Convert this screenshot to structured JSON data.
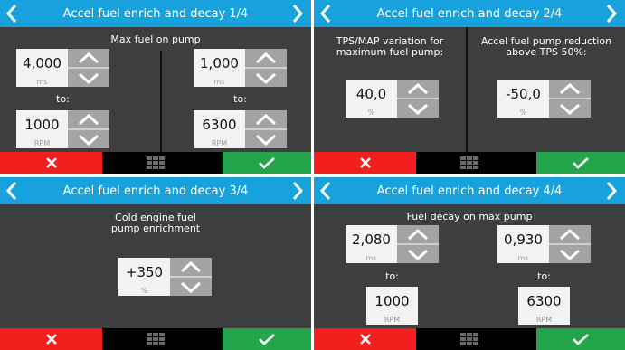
{
  "screens": [
    {
      "title": "Accel fuel enrich and decay 1/4",
      "heading": "Max fuel on pump",
      "left": {
        "value": "4,000",
        "unit": "ms",
        "to_label": "to:",
        "rpm_value": "1000",
        "rpm_unit": "RPM"
      },
      "right": {
        "value": "1,000",
        "unit": "ms",
        "to_label": "to:",
        "rpm_value": "6300",
        "rpm_unit": "RPM"
      }
    },
    {
      "title": "Accel fuel enrich and decay 2/4",
      "left": {
        "heading_line1": "TPS/MAP variation for",
        "heading_line2": "maximum fuel pump:",
        "value": "40,0",
        "unit": "%"
      },
      "right": {
        "heading_line1": "Accel fuel pump reduction",
        "heading_line2": "above TPS 50%:",
        "value": "-50,0",
        "unit": "%"
      }
    },
    {
      "title": "Accel fuel enrich and decay 3/4",
      "heading_line1": "Cold engine fuel",
      "heading_line2": "pump enrichment",
      "value": "+350",
      "unit": "%"
    },
    {
      "title": "Accel fuel enrich and decay 4/4",
      "heading": "Fuel decay on max pump",
      "left": {
        "value": "2,080",
        "unit": "ms",
        "to_label": "to:",
        "rpm_value": "1000",
        "rpm_unit": "RPM"
      },
      "right": {
        "value": "0,930",
        "unit": "ms",
        "to_label": "to:",
        "rpm_value": "6300",
        "rpm_unit": "RPM"
      }
    }
  ],
  "icons": {
    "prev": "chevron-left-icon",
    "next": "chevron-right-icon",
    "cancel": "close-x-icon",
    "menu": "grid-menu-icon",
    "confirm": "checkmark-icon",
    "increment": "chevron-up-icon",
    "decrement": "chevron-down-icon"
  },
  "colors": {
    "header": "#17a2dd",
    "panel": "#3e3e3e",
    "cancel": "#f31f1f",
    "confirm": "#23a64b",
    "stepper": "#a3a3a3",
    "value_box": "#f2f2f2"
  }
}
